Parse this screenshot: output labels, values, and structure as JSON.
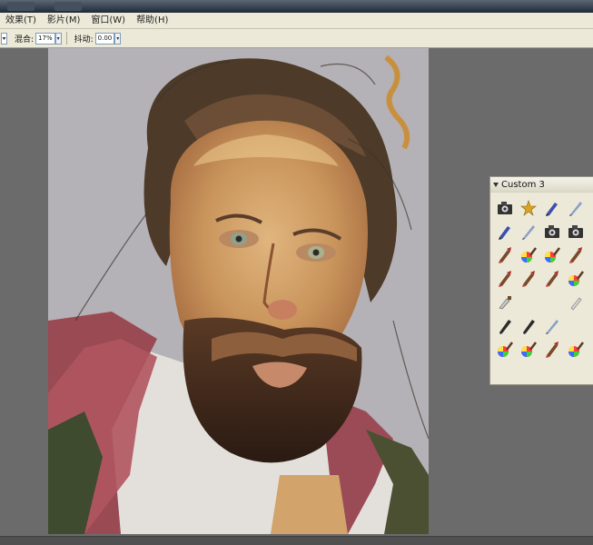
{
  "menu": {
    "items": [
      {
        "label": "效果(T)"
      },
      {
        "label": "影片(M)"
      },
      {
        "label": "窗口(W)"
      },
      {
        "label": "帮助(H)"
      }
    ]
  },
  "property_bar": {
    "blend_label": "混合:",
    "blend_value": "17%",
    "jitter_label": "抖动:",
    "jitter_value": "0.00"
  },
  "canvas": {
    "artwork": "oil-portrait-painting"
  },
  "palette": {
    "title": "Custom  3",
    "brushes": [
      {
        "name": "camera-brush-icon"
      },
      {
        "name": "star-brush-icon"
      },
      {
        "name": "blue-marker-brush-icon"
      },
      {
        "name": "pencil-brush-icon"
      },
      {
        "name": "blue-pen-brush-icon"
      },
      {
        "name": "quill-brush-icon"
      },
      {
        "name": "camera-brush-icon"
      },
      {
        "name": "camera-brush-icon"
      },
      {
        "name": "paint-brush-icon"
      },
      {
        "name": "color-wheel-brush-icon"
      },
      {
        "name": "color-wheel-brush-icon"
      },
      {
        "name": "paint-brush-icon"
      },
      {
        "name": "paint-brush-icon"
      },
      {
        "name": "paint-brush-icon"
      },
      {
        "name": "paint-brush-icon"
      },
      {
        "name": "color-wheel-brush-icon"
      },
      {
        "name": "palette-knife-icon"
      },
      {
        "name": "blender-brush-icon"
      },
      {
        "name": "dark-brush-icon"
      },
      {
        "name": "dark-brush-icon"
      },
      {
        "name": "feather-brush-icon"
      },
      {
        "name": "color-wheel-brush-icon"
      },
      {
        "name": "color-wheel-brush-icon"
      },
      {
        "name": "paint-brush-icon"
      },
      {
        "name": "color-wheel-brush-icon"
      }
    ]
  },
  "colors": {
    "ui_face": "#ece9d8",
    "workspace": "#6b6b6b",
    "canvas_bg": "#b4b2b6"
  }
}
